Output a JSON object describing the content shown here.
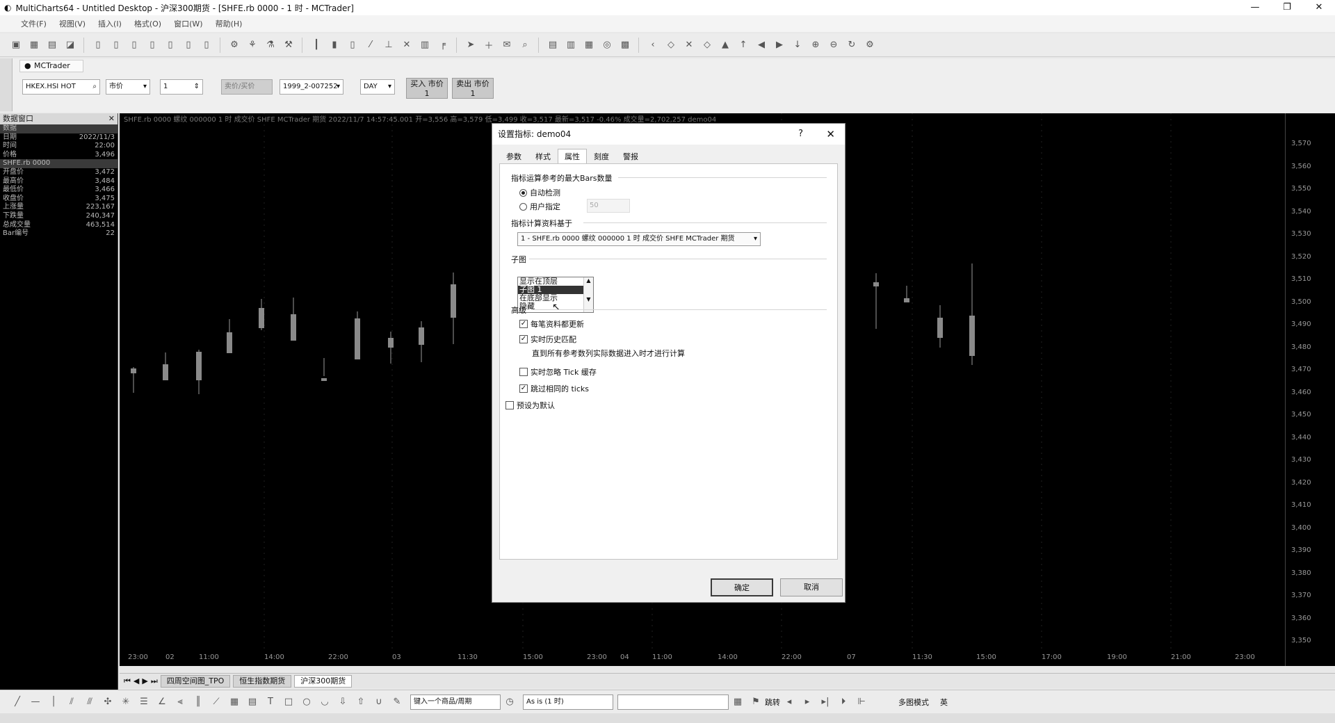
{
  "window": {
    "title": "MultiCharts64 - Untitled Desktop - 沪深300期货 - [SHFE.rb 0000 - 1 时 - MCTrader]",
    "minimize": "—",
    "maximize": "❐",
    "close": "✕"
  },
  "menu": [
    "文件(F)",
    "视图(V)",
    "插入(I)",
    "格式(O)",
    "窗口(W)",
    "帮助(H)"
  ],
  "order_bar": {
    "tab": "MCTrader",
    "symbol": "HKEX.HSI HOT",
    "order_type": "市价",
    "quantity": "1",
    "bid_ask": "卖价/买价",
    "account": "1999_2-007252",
    "tif": "DAY",
    "buy_label": "买入 市价",
    "buy_qty": "1",
    "sell_label": "卖出 市价",
    "sell_qty": "1"
  },
  "data_window": {
    "title": "数据窗口",
    "rows": [
      {
        "k": "数据",
        "v": "",
        "hl": true
      },
      {
        "k": "日期",
        "v": "2022/11/3"
      },
      {
        "k": "时间",
        "v": "22:00"
      },
      {
        "k": "价格",
        "v": "3,496"
      },
      {
        "k": "SHFE.rb 0000",
        "v": "",
        "hl": true
      },
      {
        "k": "开盘价",
        "v": "3,472"
      },
      {
        "k": "最高价",
        "v": "3,484"
      },
      {
        "k": "最低价",
        "v": "3,466"
      },
      {
        "k": "收盘价",
        "v": "3,475"
      },
      {
        "k": "上涨量",
        "v": "223,167"
      },
      {
        "k": "下跌量",
        "v": "240,347"
      },
      {
        "k": "总成交量",
        "v": "463,514"
      },
      {
        "k": "Bar编号",
        "v": "22"
      }
    ]
  },
  "chart": {
    "header": "SHFE.rb 0000  螺纹 000000 1 时  成交价  SHFE  MCTrader 期货  2022/11/7  14:57:45.001  开=3,556  高=3,579  低=3,499  收=3,517  最新=3,517  -0.46%  成交量=2,702,257  demo04",
    "y_ticks": [
      "3,570",
      "3,560",
      "3,550",
      "3,540",
      "3,530",
      "3,520",
      "3,510",
      "3,500",
      "3,490",
      "3,480",
      "3,470",
      "3,460",
      "3,450",
      "3,440",
      "3,430",
      "3,420",
      "3,410",
      "3,400",
      "3,390",
      "3,380",
      "3,370",
      "3,360",
      "3,350"
    ],
    "x_ticks": [
      "23:00",
      "02",
      "11:00",
      "14:00",
      "22:00",
      "03",
      "11:30",
      "15:00",
      "23:00",
      "04",
      "11:00",
      "14:00",
      "22:00",
      "07",
      "11:30",
      "15:00",
      "17:00",
      "19:00",
      "21:00",
      "23:00"
    ]
  },
  "sheet_tabs": [
    "四周空间图_TPO",
    "恒生指数期货",
    "沪深300期货"
  ],
  "draw_bar": {
    "symbol_input": "键入一个商品/周期",
    "resolution": "As is (1 时)",
    "jump": "跳转",
    "mode": "多图模式",
    "ime": "英"
  },
  "dialog": {
    "title": "设置指标: demo04",
    "help": "?",
    "close": "✕",
    "tabs": [
      "参数",
      "样式",
      "属性",
      "刻度",
      "警报"
    ],
    "active_tab": 2,
    "max_bars_section": "指标运算参考的最大Bars数量",
    "auto_detect": "自动检测",
    "user_specified": "用户指定",
    "user_value": "50",
    "based_on_section": "指标计算资料基于",
    "based_on_value": "1 - SHFE.rb 0000 螺纹 000000 1 时 成交价 SHFE MCTrader 期货",
    "subchart_section": "子图",
    "subchart_options": [
      "显示在顶层",
      "子图 1",
      "在底部显示",
      "隐藏"
    ],
    "subchart_selected": 1,
    "advanced_section": "高级",
    "update_every_tick": "每笔资料都更新",
    "realtime_history_match": "实时历史匹配",
    "match_note": "直到所有参考数列实际数据进入时才进行计算",
    "skip_tick_cache": "实时忽略 Tick 缓存",
    "skip_identical_ticks": "跳过相同的 ticks",
    "set_as_default": "预设为默认",
    "ok": "确定",
    "cancel": "取消"
  }
}
